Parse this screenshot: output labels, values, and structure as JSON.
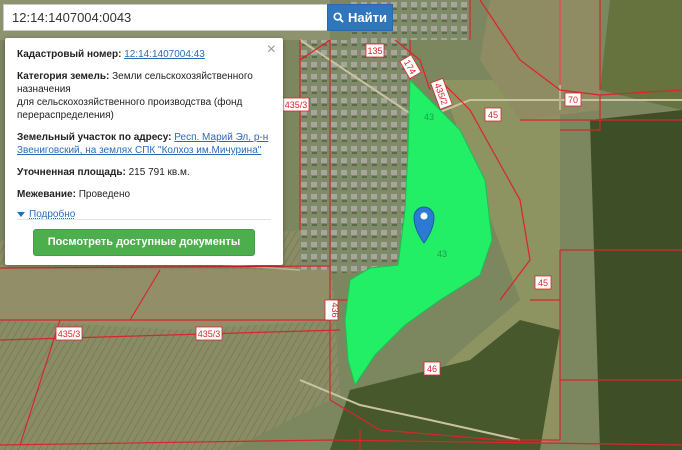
{
  "search": {
    "value": "12:14:1407004:0043",
    "button_label": "Найти"
  },
  "info_panel": {
    "cadastral_label": "Кадастровый номер:",
    "cadastral_value": "12:14:1407004:43",
    "category_label": "Категория земель:",
    "category_value_1": "Земли сельскохозяйственного назначения",
    "category_value_2": "для сельскохозяйственного производства (фонд перераспределения)",
    "address_label": "Земельный участок по адресу:",
    "address_value": "Респ. Марий Эл, р-н Звениговский, на землях СПК \"Колхоз им.Мичурина\"",
    "area_label": "Уточненная площадь:",
    "area_value": "215 791 кв.м.",
    "survey_label": "Межевание:",
    "survey_value": "Проведено",
    "more_label": "Подробно",
    "docs_button": "Посмотреть доступные документы",
    "close_symbol": "×"
  },
  "map_labels": {
    "l135": "135",
    "l174": "174",
    "l70": "70",
    "l4352a": "435/2",
    "l435_3a": "435/3",
    "l43a": "43",
    "l43b": "43",
    "l45a": "45",
    "l45b": "45",
    "l436": "436",
    "l435_3b": "435/3",
    "l435_3c": "435/3",
    "l46": "46"
  },
  "colors": {
    "parcel_fill": "#22ee66",
    "boundary": "#d8262b",
    "search_button": "#2f76bd",
    "docs_button": "#4cae4c",
    "marker": "#2b7bd2"
  },
  "icons": [
    "search-icon",
    "close-icon",
    "map-marker-icon",
    "caret-down-icon"
  ]
}
